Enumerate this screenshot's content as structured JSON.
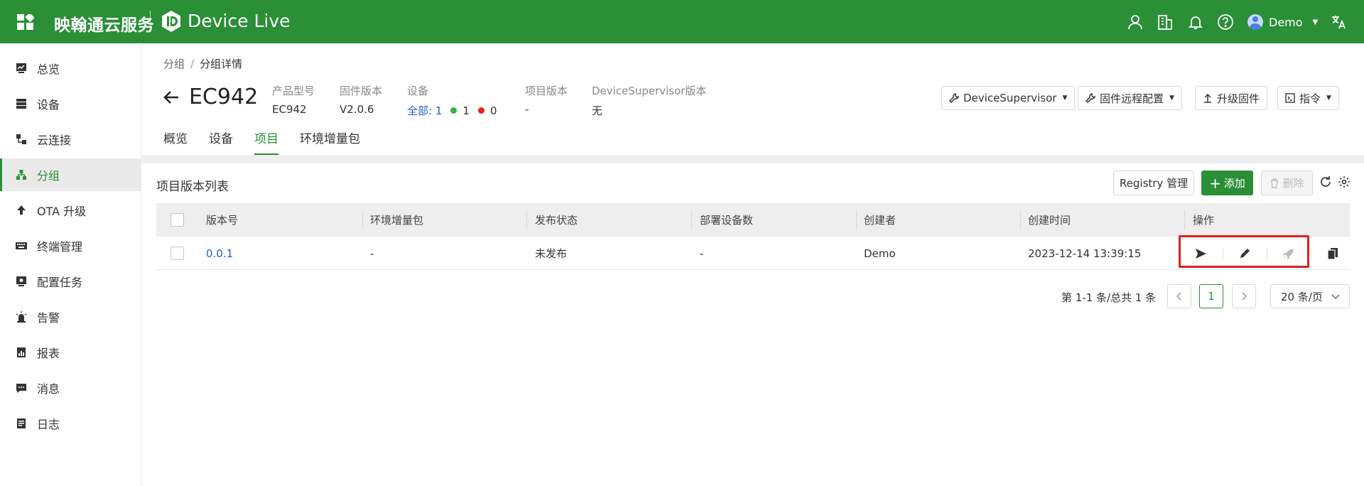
{
  "header": {
    "brand": "映翰通云服务",
    "product": "Device Live",
    "user": "Demo"
  },
  "sidebar": {
    "items": [
      {
        "label": "总览",
        "icon": "dashboard-icon"
      },
      {
        "label": "设备",
        "icon": "server-icon"
      },
      {
        "label": "云连接",
        "icon": "connection-icon"
      },
      {
        "label": "分组",
        "icon": "group-icon",
        "active": true
      },
      {
        "label": "OTA 升级",
        "icon": "upload-icon"
      },
      {
        "label": "终端管理",
        "icon": "keyboard-icon"
      },
      {
        "label": "配置任务",
        "icon": "task-icon"
      },
      {
        "label": "告警",
        "icon": "alarm-icon"
      },
      {
        "label": "报表",
        "icon": "report-icon"
      },
      {
        "label": "消息",
        "icon": "message-icon"
      },
      {
        "label": "日志",
        "icon": "log-icon"
      }
    ]
  },
  "breadcrumb": {
    "parent": "分组",
    "current": "分组详情"
  },
  "device": {
    "name": "EC942",
    "model_label": "产品型号",
    "model": "EC942",
    "firmware_label": "固件版本",
    "firmware": "V2.0.6",
    "devices_label": "设备",
    "devices_all": "全部:",
    "devices_total": "1",
    "devices_online": "1",
    "devices_offline": "0",
    "project_version_label": "项目版本",
    "project_version": "-",
    "ds_version_label": "DeviceSupervisor版本",
    "ds_version": "无"
  },
  "actions": {
    "device_supervisor": "DeviceSupervisor",
    "firmware_remote_config": "固件远程配置",
    "upgrade_firmware": "升级固件",
    "command": "指令"
  },
  "tabs": [
    "概览",
    "设备",
    "项目",
    "环境增量包"
  ],
  "section": {
    "title": "项目版本列表",
    "registry": "Registry 管理",
    "add": "添加",
    "delete": "删除"
  },
  "table": {
    "columns": [
      "版本号",
      "环境增量包",
      "发布状态",
      "部署设备数",
      "创建者",
      "创建时间",
      "操作"
    ],
    "rows": [
      {
        "version": "0.0.1",
        "env_pkg": "-",
        "status": "未发布",
        "deployed": "-",
        "creator": "Demo",
        "created": "2023-12-14 13:39:15"
      }
    ]
  },
  "pagination": {
    "summary": "第 1-1 条/总共 1 条",
    "current": "1",
    "page_size": "20 条/页"
  },
  "colors": {
    "brand": "#2a8f36",
    "link": "#2160c4",
    "online": "#2fb344",
    "offline": "#e02020",
    "highlight": "#e02020"
  }
}
